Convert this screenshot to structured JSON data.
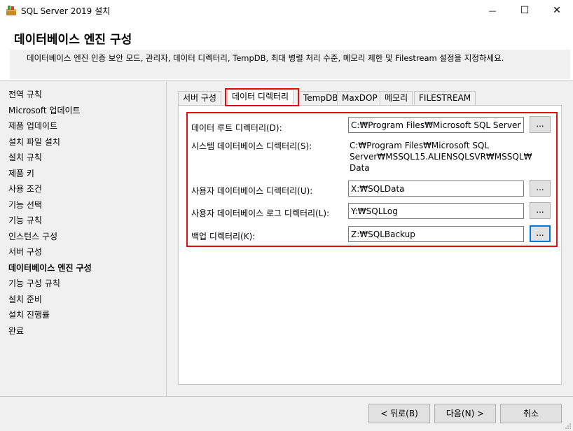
{
  "window": {
    "title": "SQL Server 2019 설치",
    "min_glyph": "—",
    "max_glyph": "☐",
    "close_glyph": "✕"
  },
  "header": {
    "title": "데이터베이스 엔진 구성",
    "description": "데이터베이스 엔진 인증 보안 모드, 관리자, 데이터 디렉터리, TempDB, 최대 병렬 처리 수준, 메모리 제한 및 Filestream 설정을 지정하세요."
  },
  "nav": {
    "items": [
      {
        "label": "전역 규칙"
      },
      {
        "label": "Microsoft 업데이트"
      },
      {
        "label": "제품 업데이트"
      },
      {
        "label": "설치 파일 설치"
      },
      {
        "label": "설치 규칙"
      },
      {
        "label": "제품 키"
      },
      {
        "label": "사용 조건"
      },
      {
        "label": "기능 선택"
      },
      {
        "label": "기능 규칙"
      },
      {
        "label": "인스턴스 구성"
      },
      {
        "label": "서버 구성"
      },
      {
        "label": "데이터베이스 엔진 구성"
      },
      {
        "label": "기능 구성 규칙"
      },
      {
        "label": "설치 준비"
      },
      {
        "label": "설치 진행률"
      },
      {
        "label": "완료"
      }
    ],
    "active": "데이터베이스 엔진 구성"
  },
  "tabs": [
    {
      "label": "서버 구성"
    },
    {
      "label": "데이터 디렉터리"
    },
    {
      "label": "TempDB"
    },
    {
      "label": "MaxDOP"
    },
    {
      "label": "메모리"
    },
    {
      "label": "FILESTREAM"
    }
  ],
  "selected_tab": "데이터 디렉터리",
  "fields": {
    "data_root": {
      "label": "데이터 루트 디렉터리(D):",
      "value": "C:₩Program Files₩Microsoft SQL Server₩"
    },
    "system_db": {
      "label": "시스템 데이터베이스 디렉터리(S):",
      "value_lines": [
        "C:₩Program Files₩Microsoft SQL",
        "Server₩MSSQL15.ALIENSQLSVR₩MSSQL₩",
        "Data"
      ]
    },
    "user_db": {
      "label": "사용자 데이터베이스 디렉터리(U):",
      "value": "X:₩SQLData"
    },
    "user_db_log": {
      "label": "사용자 데이터베이스 로그 디렉터리(L):",
      "value": "Y:₩SQLLog"
    },
    "backup": {
      "label": "백업 디렉터리(K):",
      "value": "Z:₩SQLBackup"
    }
  },
  "browse_label": "...",
  "footer": {
    "back": "< 뒤로(B)",
    "next": "다음(N) >",
    "cancel": "취소"
  },
  "colors": {
    "highlight_red": "#e01010",
    "focus_blue": "#0078d7"
  }
}
